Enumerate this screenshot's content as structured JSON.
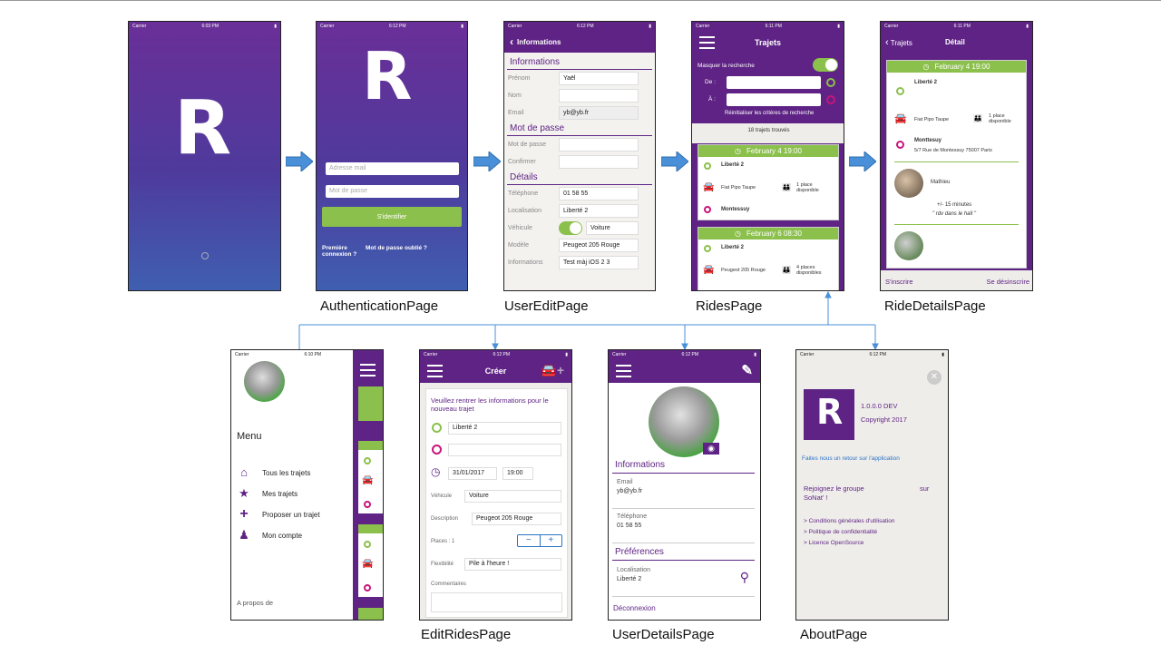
{
  "captions": {
    "auth": "AuthenticationPage",
    "useredit": "UserEditPage",
    "rides": "RidesPage",
    "ridedetails": "RideDetailsPage",
    "editrides": "EditRidesPage",
    "userdetails": "UserDetailsPage",
    "about": "AboutPage"
  },
  "status": {
    "carrier": "Carrier",
    "time1": "6:03 PM",
    "time2": "6:12 PM",
    "time3": "6:12 PM",
    "time4": "6:11 PM",
    "time5": "6:11 PM",
    "time6": "6:10 PM",
    "time7": "6:12 PM",
    "time8": "6:12 PM"
  },
  "logo": {
    "letter": "R"
  },
  "auth": {
    "email_placeholder": "Adresse mail",
    "password_placeholder": "Mot de passe",
    "login_button": "S'identifier",
    "first_connection": "Première connexion ?",
    "forgot_password": "Mot de passe oublié ?"
  },
  "useredit": {
    "nav_title": "Informations",
    "section_info": "Informations",
    "section_password": "Mot de passe",
    "section_details": "Détails",
    "fields": [
      {
        "label": "Prénom",
        "value": "Yaël"
      },
      {
        "label": "Nom",
        "value": ""
      },
      {
        "label": "Email",
        "value": "yb@yb.fr"
      }
    ],
    "password_fields": [
      {
        "label": "Mot de passe",
        "value": ""
      },
      {
        "label": "Confirmer",
        "value": ""
      }
    ],
    "detail_fields": [
      {
        "label": "Téléphone",
        "value": "01 58 55"
      },
      {
        "label": "Localisation",
        "value": "Liberté 2"
      },
      {
        "label": "Véhicule",
        "value": "Voiture"
      },
      {
        "label": "Modèle",
        "value": "Peugeot 205 Rouge"
      },
      {
        "label": "Informations",
        "value": "Test màj  iOS 2 3"
      }
    ]
  },
  "rides": {
    "nav_title": "Trajets",
    "hide_search": "Masquer la recherche",
    "from_label": "De :",
    "to_label": "À :",
    "reset_link": "Réinitialiser les critères de recherche",
    "count": "18 trajets trouvés",
    "card1": {
      "date": "February 4  19:00",
      "from": "Liberté 2",
      "car": "Fiat Pipo Taupe",
      "places": "1 place disponible",
      "to": "Montessuy"
    },
    "card2": {
      "date": "February 6  08:30",
      "from": "Liberté 2",
      "car": "Peugeot 205 Rouge",
      "places": "4 places disponibles"
    }
  },
  "ridedetails": {
    "back": "Trajets",
    "nav_title": "Détail",
    "date": "February 4  19:00",
    "from": "Liberté 2",
    "car": "Fiat Pipo Taupe",
    "places": "1 place disponible",
    "to": "Monttesuy",
    "to_address": "5/7 Rue de Montessuy 75007 Paris",
    "driver": "Mathieu",
    "flex": "+/- 15 minutes",
    "comment": "\" rdv dans le hall \"",
    "subscribe": "S'inscrire",
    "unsubscribe": "Se désinscrire"
  },
  "menu": {
    "title": "Menu",
    "items": [
      "Tous les trajets",
      "Mes trajets",
      "Proposer un trajet",
      "Mon compte"
    ],
    "about": "A propos de"
  },
  "editrides": {
    "nav_title": "Créer",
    "intro": "Veuillez rentrer les informations pour le nouveau trajet",
    "from": "Liberté 2",
    "to": "",
    "date": "31/01/2017",
    "time": "19:00",
    "vehicle_label": "Véhicule",
    "vehicle": "Voiture",
    "desc_label": "Description",
    "desc": "Peugeot 205 Rouge",
    "places_label": "Places : 1",
    "minus": "−",
    "plus": "+",
    "flex_label": "Flexibilité",
    "flex": "Pile à l'heure !",
    "comments_label": "Commentaires"
  },
  "userdetails": {
    "section_info": "Informations",
    "email_label": "Email",
    "email": "yb@yb.fr",
    "phone_label": "Téléphone",
    "phone": "01 58 55",
    "section_prefs": "Préférences",
    "loc_label": "Localisation",
    "loc": "Liberté 2",
    "logout": "Déconnexion"
  },
  "about": {
    "version": "1.0.0.0 DEV",
    "copyright": "Copyright 2017",
    "feedback": "Faites nous un retour sur l'application",
    "join": "Rejoignez le groupe",
    "sur": "sur",
    "sonat": "SoNat' !",
    "links": [
      "> Conditions générales d'utilisation",
      "> Politique de confidentialité",
      "> Licence OpenSource"
    ]
  },
  "colors": {
    "brand": "#5e2384",
    "accent_green": "#8cc04c",
    "pink": "#c8157c",
    "arrow_blue": "#4a90d9"
  }
}
